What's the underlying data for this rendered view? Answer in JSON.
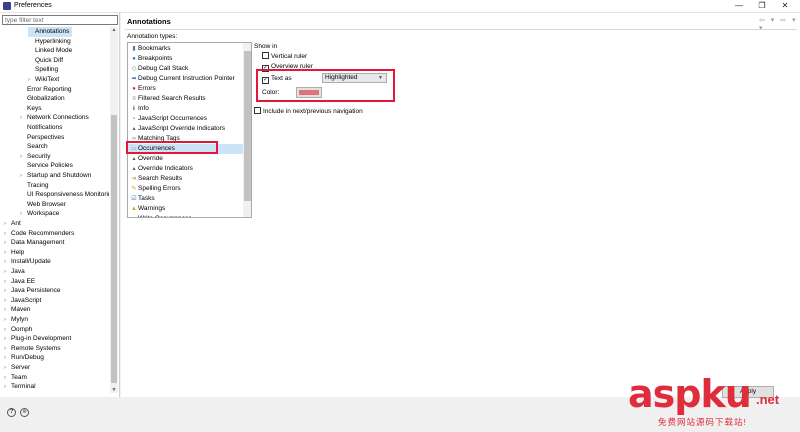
{
  "window": {
    "title": "Preferences",
    "controls": [
      "—",
      "❐",
      "✕"
    ]
  },
  "left_panel": {
    "filter_placeholder": "type filter text",
    "tree": [
      {
        "label": "Annotations",
        "indent": 3,
        "arrow": "",
        "selected": true
      },
      {
        "label": "Hyperlinking",
        "indent": 3,
        "arrow": ""
      },
      {
        "label": "Linked Mode",
        "indent": 3,
        "arrow": ""
      },
      {
        "label": "Quick Diff",
        "indent": 3,
        "arrow": ""
      },
      {
        "label": "Spelling",
        "indent": 3,
        "arrow": ""
      },
      {
        "label": "WikiText",
        "indent": 3,
        "arrow": "›"
      },
      {
        "label": "Error Reporting",
        "indent": 2,
        "arrow": ""
      },
      {
        "label": "Globalization",
        "indent": 2,
        "arrow": ""
      },
      {
        "label": "Keys",
        "indent": 2,
        "arrow": ""
      },
      {
        "label": "Network Connections",
        "indent": 2,
        "arrow": "›"
      },
      {
        "label": "Notifications",
        "indent": 2,
        "arrow": ""
      },
      {
        "label": "Perspectives",
        "indent": 2,
        "arrow": ""
      },
      {
        "label": "Search",
        "indent": 2,
        "arrow": ""
      },
      {
        "label": "Security",
        "indent": 2,
        "arrow": "›"
      },
      {
        "label": "Service Policies",
        "indent": 2,
        "arrow": ""
      },
      {
        "label": "Startup and Shutdown",
        "indent": 2,
        "arrow": "›"
      },
      {
        "label": "Tracing",
        "indent": 2,
        "arrow": ""
      },
      {
        "label": "UI Responsiveness Monitoring",
        "indent": 2,
        "arrow": ""
      },
      {
        "label": "Web Browser",
        "indent": 2,
        "arrow": ""
      },
      {
        "label": "Workspace",
        "indent": 2,
        "arrow": "›"
      },
      {
        "label": "Ant",
        "indent": 0,
        "arrow": "›"
      },
      {
        "label": "Code Recommenders",
        "indent": 0,
        "arrow": "›"
      },
      {
        "label": "Data Management",
        "indent": 0,
        "arrow": "›"
      },
      {
        "label": "Help",
        "indent": 0,
        "arrow": "›"
      },
      {
        "label": "Install/Update",
        "indent": 0,
        "arrow": "›"
      },
      {
        "label": "Java",
        "indent": 0,
        "arrow": "›"
      },
      {
        "label": "Java EE",
        "indent": 0,
        "arrow": "›"
      },
      {
        "label": "Java Persistence",
        "indent": 0,
        "arrow": "›"
      },
      {
        "label": "JavaScript",
        "indent": 0,
        "arrow": "›"
      },
      {
        "label": "Maven",
        "indent": 0,
        "arrow": "›"
      },
      {
        "label": "Mylyn",
        "indent": 0,
        "arrow": "›"
      },
      {
        "label": "Oomph",
        "indent": 0,
        "arrow": "›"
      },
      {
        "label": "Plug-in Development",
        "indent": 0,
        "arrow": "›"
      },
      {
        "label": "Remote Systems",
        "indent": 0,
        "arrow": "›"
      },
      {
        "label": "Run/Debug",
        "indent": 0,
        "arrow": "›"
      },
      {
        "label": "Server",
        "indent": 0,
        "arrow": "›"
      },
      {
        "label": "Team",
        "indent": 0,
        "arrow": "›"
      },
      {
        "label": "Terminal",
        "indent": 0,
        "arrow": "›"
      }
    ]
  },
  "main": {
    "title": "Annotations",
    "nav_arrows": "⇦ ▾ ⇨ ▾ ▾",
    "types_label": "Annotation types:",
    "types": [
      {
        "label": "Bookmarks",
        "icon": "▮",
        "color": "#4a78c2"
      },
      {
        "label": "Breakpoints",
        "icon": "●",
        "color": "#2b6fb8"
      },
      {
        "label": "Debug Call Stack",
        "icon": "◇",
        "color": "#5a8a5a"
      },
      {
        "label": "Debug Current Instruction Pointer",
        "icon": "➡",
        "color": "#2b6fb8"
      },
      {
        "label": "Errors",
        "icon": "●",
        "color": "#d9342b"
      },
      {
        "label": "Filtered Search Results",
        "icon": "≡",
        "color": "#7a7a7a"
      },
      {
        "label": "Info",
        "icon": "ℹ",
        "color": "#2b6fb8"
      },
      {
        "label": "JavaScript Occurrences",
        "icon": "▪",
        "color": "#c99a2e"
      },
      {
        "label": "JavaScript Override Indicators",
        "icon": "▴",
        "color": "#5a5a5a"
      },
      {
        "label": "Matching Tags",
        "icon": "‹›",
        "color": "#5a5a5a"
      },
      {
        "label": "Occurrences",
        "icon": "▭",
        "color": "#8a8a8a",
        "selected": true
      },
      {
        "label": "Override",
        "icon": "▴",
        "color": "#5a5a5a"
      },
      {
        "label": "Override Indicators",
        "icon": "▴",
        "color": "#5a5a5a"
      },
      {
        "label": "Search Results",
        "icon": "➔",
        "color": "#c99a2e"
      },
      {
        "label": "Spelling Errors",
        "icon": "✎",
        "color": "#c99a2e"
      },
      {
        "label": "Tasks",
        "icon": "☑",
        "color": "#2b6fb8"
      },
      {
        "label": "Warnings",
        "icon": "▲",
        "color": "#d9a400"
      },
      {
        "label": "Write Occurrences",
        "icon": "▪",
        "color": "#c99a2e"
      }
    ],
    "show_in_label": "Show in",
    "vertical_ruler": {
      "label": "Vertical ruler",
      "checked": false
    },
    "overview_ruler": {
      "label": "Overview ruler",
      "checked": true
    },
    "text_as": {
      "label": "Text as",
      "checked": true,
      "value": "Highlighted"
    },
    "color_label": "Color:",
    "color_value": "#e0737a",
    "nav_include": {
      "label": "Include in next/previous navigation",
      "checked": false
    },
    "highlight_color": "#e0193a"
  },
  "footer": {
    "help_icon": "?",
    "prefs_icon": "⊜",
    "apply_label": "Apply"
  },
  "watermark": {
    "main": "asp",
    "ku": "ku",
    "net": ".net",
    "sub": "免费网站源码下载站!"
  }
}
